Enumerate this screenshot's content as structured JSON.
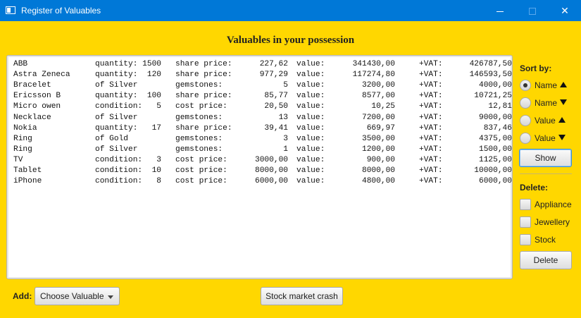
{
  "window": {
    "title": "Register of Valuables",
    "minimize_icon": "minimize-icon",
    "maximize_icon": "maximize-icon",
    "close_glyph": "✕"
  },
  "heading": "Valuables in your possession",
  "valuables": [
    [
      "ABB",
      "quantity: 1500",
      "share price:",
      "227,62",
      "value:",
      "341430,00",
      "+VAT:",
      "426787,50"
    ],
    [
      "Astra Zeneca",
      "quantity:  120",
      "share price:",
      "977,29",
      "value:",
      "117274,80",
      "+VAT:",
      "146593,50"
    ],
    [
      "Bracelet",
      "of Silver",
      "gemstones:",
      "5",
      "value:",
      "3200,00",
      "+VAT:",
      "4000,00"
    ],
    [
      "Ericsson B",
      "quantity:  100",
      "share price:",
      "85,77",
      "value:",
      "8577,00",
      "+VAT:",
      "10721,25"
    ],
    [
      "Micro owen",
      "condition:   5",
      "cost price:",
      "20,50",
      "value:",
      "10,25",
      "+VAT:",
      "12,81"
    ],
    [
      "Necklace",
      "of Silver",
      "gemstones:",
      "13",
      "value:",
      "7200,00",
      "+VAT:",
      "9000,00"
    ],
    [
      "Nokia",
      "quantity:   17",
      "share price:",
      "39,41",
      "value:",
      "669,97",
      "+VAT:",
      "837,46"
    ],
    [
      "Ring",
      "of Gold",
      "gemstones:",
      "3",
      "value:",
      "3500,00",
      "+VAT:",
      "4375,00"
    ],
    [
      "Ring",
      "of Silver",
      "gemstones:",
      "1",
      "value:",
      "1200,00",
      "+VAT:",
      "1500,00"
    ],
    [
      "TV",
      "condition:   3",
      "cost price:",
      "3000,00",
      "value:",
      "900,00",
      "+VAT:",
      "1125,00"
    ],
    [
      "Tablet",
      "condition:  10",
      "cost price:",
      "8000,00",
      "value:",
      "8000,00",
      "+VAT:",
      "10000,00"
    ],
    [
      "iPhone",
      "condition:   8",
      "cost price:",
      "6000,00",
      "value:",
      "4800,00",
      "+VAT:",
      "6000,00"
    ]
  ],
  "sort": {
    "label": "Sort by:",
    "options": [
      {
        "label": "Name",
        "direction": "up",
        "selected": true
      },
      {
        "label": "Name",
        "direction": "down",
        "selected": false
      },
      {
        "label": "Value",
        "direction": "up",
        "selected": false
      },
      {
        "label": "Value",
        "direction": "down",
        "selected": false
      }
    ],
    "show_label": "Show"
  },
  "delete": {
    "label": "Delete:",
    "options": [
      {
        "label": "Appliance",
        "checked": false
      },
      {
        "label": "Jewellery",
        "checked": false
      },
      {
        "label": "Stock",
        "checked": false
      }
    ],
    "button_label": "Delete"
  },
  "add": {
    "label": "Add:",
    "combo_value": "Choose Valuable"
  },
  "crash_label": "Stock market crash"
}
